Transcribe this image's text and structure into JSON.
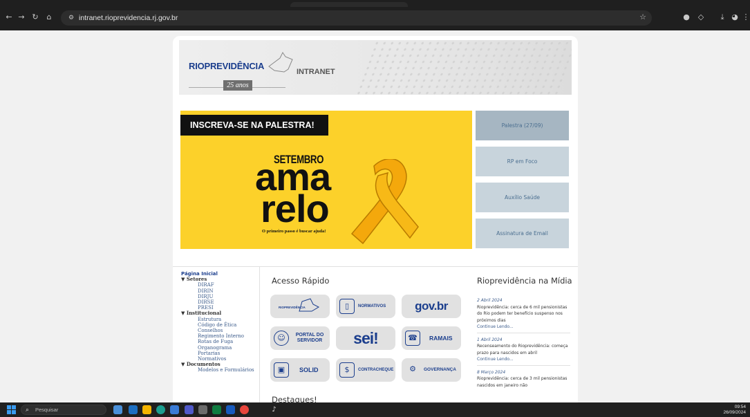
{
  "browser": {
    "url": "intranet.rioprevidencia.rj.gov.br"
  },
  "header": {
    "logo_text": "RIOPREVIDÊNCIA",
    "logo_anos": "25 anos",
    "title": "INTRANET"
  },
  "hero": {
    "strip_text": "INSCREVA-SE NA PALESTRA!",
    "setembro": "SETEMBRO",
    "ama": "ama",
    "relo": "relo",
    "caption": "O primeiro passo é buscar ajuda!"
  },
  "side_buttons": [
    {
      "label": "Palestra (27/09)"
    },
    {
      "label": "RP em Foco"
    },
    {
      "label": "Auxílio Saúde"
    },
    {
      "label": "Assinatura de Email"
    }
  ],
  "sidebar": {
    "home": "Página Inicial",
    "setores": {
      "label": "▼ Setores",
      "items": [
        "DIRAF",
        "DIRIN",
        "DIRJU",
        "DIRSE",
        "PRESI"
      ]
    },
    "institucional": {
      "label": "▼ Institucional",
      "items": [
        "Estrutura",
        "Código de Ética",
        "Conselhos",
        "Regimento Interno",
        "Rotas de Fuga",
        "Organograma",
        "Portarias",
        "Normativos"
      ]
    },
    "documentos": {
      "label": "▼ Documentos",
      "items": [
        "Modelos e Formulários"
      ]
    }
  },
  "acesso_rapido": {
    "title": "Acesso Rápido",
    "tiles": {
      "rioprevidencia": "RIOPREVIDÊNCIA",
      "normativos": "NORMATIVOS",
      "govbr": "gov.br",
      "portal_servidor": "PORTAL DO SERVIDOR",
      "sei": "sei!",
      "ramais": "RAMAIS",
      "solid": "SOLID",
      "contracheque": "CONTRACHEQUE",
      "governanca": "GOVERNANÇA"
    }
  },
  "destaques": {
    "title": "Destaques!"
  },
  "midia": {
    "title": "Rioprevidência na Mídia",
    "news": [
      {
        "date": "2 Abril 2024",
        "text": "Rioprevidência: cerca de 6 mil pensionistas do Rio podem ter benefício suspenso nos próximos dias",
        "more": "Continue Lendo..."
      },
      {
        "date": "1 Abril 2024",
        "text": "Recenseamento do Rioprevidência: começa prazo para nascidos em abril",
        "more": "Continue Lendo..."
      },
      {
        "date": "8 Março 2024",
        "text": "Rioprevidência: cerca de 3 mil pensionistas nascidos em janeiro não",
        "more": ""
      }
    ]
  },
  "taskbar": {
    "search_placeholder": "Pesquisar",
    "time": "09:54",
    "date": "26/09/2024"
  },
  "colors": {
    "brand_blue": "#1b3e8d",
    "hero_yellow": "#fcd12a",
    "side_button": "#c8d4dc",
    "side_button_active": "#a6b6c2"
  }
}
